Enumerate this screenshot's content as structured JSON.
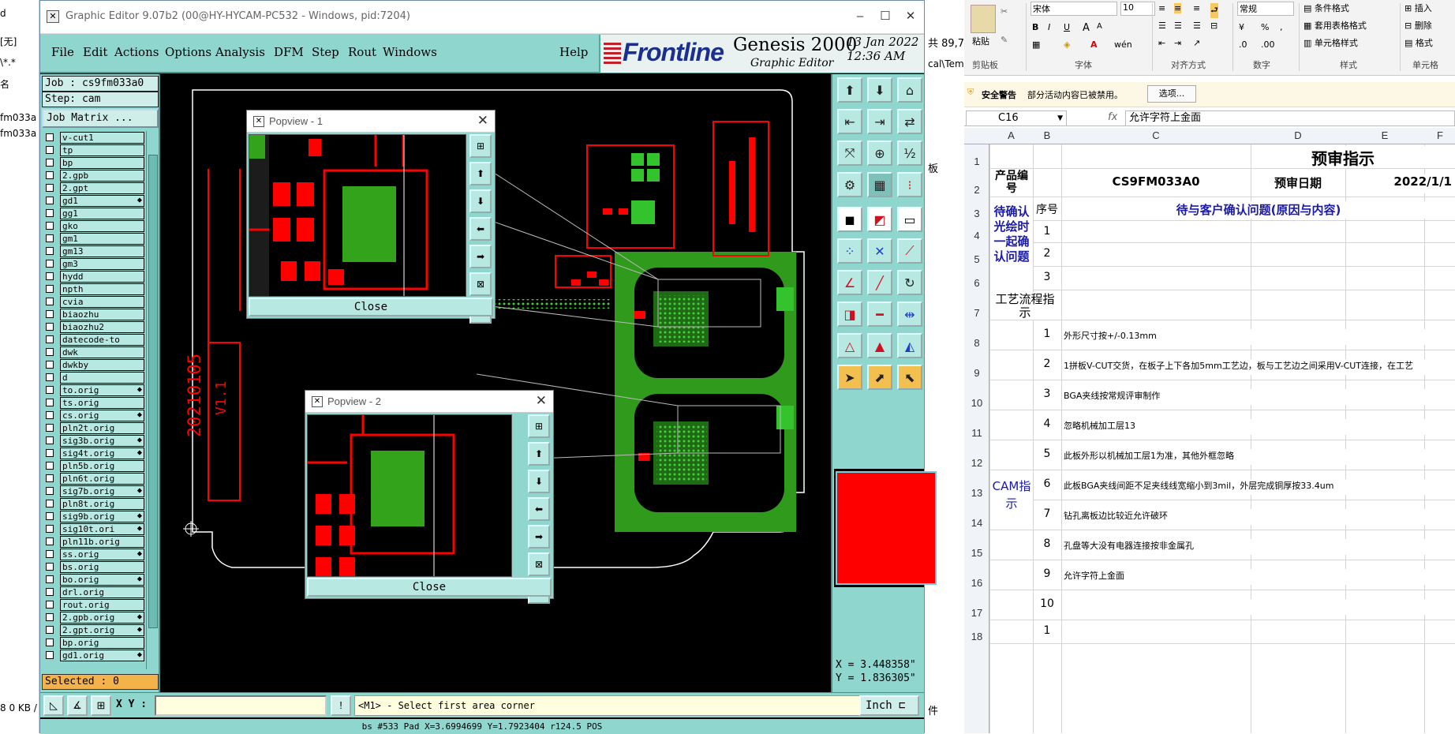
{
  "background_app": {
    "lines": [
      "d",
      "[无]",
      "\\*.*",
      "名",
      "fm033a",
      "fm033a",
      "8 0 KB /",
      "文件"
    ]
  },
  "genesis": {
    "title": "Graphic Editor 9.07b2 (00@HY-HYCAM-PC532 - Windows, pid:7204)",
    "menus": [
      "File",
      "Edit",
      "Actions",
      "Options",
      "Analysis",
      "DFM",
      "Step",
      "Rout",
      "Windows"
    ],
    "help": "Help",
    "brand": {
      "logo": "Frontline",
      "product": "Genesis 2000",
      "subtitle": "Graphic Editor",
      "date": "13 Jan 2022",
      "time": "12:36 AM"
    },
    "job": "Job : cs9fm033a0",
    "step": "Step: cam",
    "job_matrix": "Job Matrix ...",
    "layers": [
      {
        "name": "v-cut1",
        "mark": ""
      },
      {
        "name": "tp",
        "mark": ""
      },
      {
        "name": "bp",
        "mark": ""
      },
      {
        "name": "2.gpb",
        "mark": ""
      },
      {
        "name": "2.gpt",
        "mark": ""
      },
      {
        "name": "gd1",
        "mark": "⬥"
      },
      {
        "name": "gg1",
        "mark": ""
      },
      {
        "name": "gko",
        "mark": ""
      },
      {
        "name": "gm1",
        "mark": ""
      },
      {
        "name": "gm13",
        "mark": ""
      },
      {
        "name": "gm3",
        "mark": ""
      },
      {
        "name": "hydd",
        "mark": ""
      },
      {
        "name": "npth",
        "mark": ""
      },
      {
        "name": "cvia",
        "mark": ""
      },
      {
        "name": "biaozhu",
        "mark": ""
      },
      {
        "name": "biaozhu2",
        "mark": ""
      },
      {
        "name": "datecode-to",
        "mark": ""
      },
      {
        "name": "dwk",
        "mark": ""
      },
      {
        "name": "dwkby",
        "mark": ""
      },
      {
        "name": "d",
        "mark": ""
      },
      {
        "name": "to.orig",
        "mark": "⬥"
      },
      {
        "name": "ts.orig",
        "mark": ""
      },
      {
        "name": "cs.orig",
        "mark": "⬥"
      },
      {
        "name": "pln2t.orig",
        "mark": ""
      },
      {
        "name": "sig3b.orig",
        "mark": "⬥"
      },
      {
        "name": "sig4t.orig",
        "mark": "⬥"
      },
      {
        "name": "pln5b.orig",
        "mark": ""
      },
      {
        "name": "pln6t.orig",
        "mark": ""
      },
      {
        "name": "sig7b.orig",
        "mark": "⬥"
      },
      {
        "name": "pln8t.orig",
        "mark": ""
      },
      {
        "name": "sig9b.orig",
        "mark": "⬥"
      },
      {
        "name": "sig10t.ori",
        "mark": "⬥"
      },
      {
        "name": "pln11b.orig",
        "mark": ""
      },
      {
        "name": "ss.orig",
        "mark": "⬥"
      },
      {
        "name": "bs.orig",
        "mark": ""
      },
      {
        "name": "bo.orig",
        "mark": "⬥"
      },
      {
        "name": "drl.orig",
        "mark": ""
      },
      {
        "name": "rout.orig",
        "mark": ""
      },
      {
        "name": "2.gpb.orig",
        "mark": "⬥"
      },
      {
        "name": "2.gpt.orig",
        "mark": "⬥"
      },
      {
        "name": "bp.orig",
        "mark": ""
      },
      {
        "name": "gd1.orig",
        "mark": "⬥"
      }
    ],
    "selected": "Selected : 0",
    "popview1": {
      "title": "Popview - 1",
      "close": "Close"
    },
    "popview2": {
      "title": "Popview - 2",
      "close": "Close"
    },
    "board_text": {
      "date": "20210105",
      "ver": "V1.1"
    },
    "coords": {
      "x": "X = 3.448358\"",
      "y": "Y = 1.836305\""
    },
    "xy_label": "X Y :",
    "hint": "<M1> - Select first area corner",
    "unit": "Inch",
    "status": "bs #533 Pad X=3.6994699 Y=1.7923404 r124.5 POS"
  },
  "excel": {
    "ribbon": {
      "font_name": "宋体",
      "font_size": "10",
      "number_format": "常规",
      "paste": "粘贴",
      "cond_format": "条件格式",
      "table_format": "套用表格格式",
      "cell_style": "单元格样式",
      "insert": "插入",
      "delete": "删除",
      "format": "格式",
      "groups": [
        "剪贴板",
        "字体",
        "对齐方式",
        "数字",
        "样式",
        "单元格"
      ]
    },
    "security": {
      "title": "安全警告",
      "message": "部分活动内容已被禁用。",
      "button": "选项..."
    },
    "name_box": "C16",
    "formula": "允许字符上金面",
    "columns": [
      "A",
      "B",
      "C",
      "D",
      "E",
      "F"
    ],
    "rows": [
      "1",
      "2",
      "3",
      "4",
      "5",
      "6",
      "7",
      "8",
      "9",
      "10",
      "11",
      "12",
      "13",
      "14",
      "15",
      "16",
      "17",
      "18"
    ],
    "sheet_title": "预审指示",
    "product_label": "产品编号",
    "product_code": "CS9FM033A0",
    "review_date_label": "预审日期",
    "review_date": "2022/1/1",
    "seq_label": "序号",
    "confirm_header": "待与客户确认问题(原因与内容)",
    "confirm_group": "待确认光绘时一起确认问题",
    "process_label": "工艺流程指示",
    "cam_label": "CAM指示",
    "numbers_top": [
      "1",
      "2",
      "3"
    ],
    "cam_items": [
      {
        "no": "1",
        "text": "外形尺寸按+/-0.13mm"
      },
      {
        "no": "2",
        "text": "1拼板V-CUT交货，在板子上下各加5mm工艺边，板与工艺边之间采用V-CUT连接，在工艺"
      },
      {
        "no": "3",
        "text": "BGA夹线按常规评审制作"
      },
      {
        "no": "4",
        "text": "忽略机械加工层13"
      },
      {
        "no": "5",
        "text": "此板外形以机械加工层1为准，其他外框忽略"
      },
      {
        "no": "6",
        "text": "此板BGA夹线间距不足夹线线宽缩小到3mil，外层完成铜厚按33.4um"
      },
      {
        "no": "7",
        "text": "钻孔离板边比较近允许破环"
      },
      {
        "no": "8",
        "text": "孔盘等大没有电器连接按非金属孔"
      },
      {
        "no": "9",
        "text": "允许字符上金面"
      },
      {
        "no": "10",
        "text": ""
      }
    ],
    "row18_no": "1",
    "side_text": "板",
    "cut_text": "共 89,7",
    "cut_text2": "cal\\Tem",
    "cut_text3": "件"
  },
  "colors": {
    "genesis_panel": "#8fd6cf",
    "pcb_green": "#33a31c",
    "pcb_red": "#ff0000",
    "excel_blue": "#1a1aa8"
  }
}
